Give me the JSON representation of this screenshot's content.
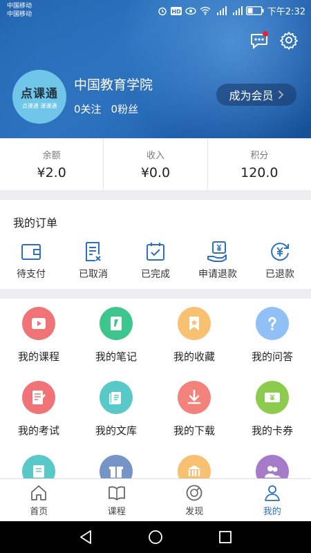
{
  "status_bar": {
    "carrier_line1": "中国移动",
    "carrier_line2": "中国移动",
    "time": "下午2:32",
    "icons": [
      "alarm-icon",
      "hd-icon",
      "eye-icon",
      "wifi-icon",
      "signal-4g-icon",
      "signal-2g-icon",
      "battery-icon"
    ]
  },
  "header": {
    "message_icon": "chat-icon",
    "settings_icon": "gear-icon",
    "has_notification": true,
    "avatar_text": "点课通",
    "avatar_subtext": "点课通 课课通",
    "name": "中国教育学院",
    "follow": "0关注",
    "fans": "0粉丝",
    "vip_label": "成为会员"
  },
  "stats": [
    {
      "label": "余额",
      "value": "¥2.0"
    },
    {
      "label": "收入",
      "value": "¥0.0"
    },
    {
      "label": "积分",
      "value": "120.0"
    }
  ],
  "orders": {
    "title": "我的订单",
    "items": [
      {
        "label": "待支付",
        "icon": "wallet-icon"
      },
      {
        "label": "已取消",
        "icon": "cancelled-doc-icon"
      },
      {
        "label": "已完成",
        "icon": "completed-check-icon"
      },
      {
        "label": "申请退款",
        "icon": "refund-request-icon"
      },
      {
        "label": "已退款",
        "icon": "refunded-icon"
      }
    ]
  },
  "services": [
    {
      "label": "我的课程",
      "icon": "course-play-icon",
      "color": "#f07377"
    },
    {
      "label": "我的笔记",
      "icon": "note-pen-icon",
      "color": "#3ec58e"
    },
    {
      "label": "我的收藏",
      "icon": "favorite-star-icon",
      "color": "#f8c071"
    },
    {
      "label": "我的问答",
      "icon": "question-icon",
      "color": "#90c0f6"
    },
    {
      "label": "我的考试",
      "icon": "exam-icon",
      "color": "#f07377"
    },
    {
      "label": "我的文库",
      "icon": "library-icon",
      "color": "#58c9c8"
    },
    {
      "label": "我的下载",
      "icon": "download-icon",
      "color": "#f4827c"
    },
    {
      "label": "我的卡券",
      "icon": "coupon-icon",
      "color": "#8dcb4f"
    },
    {
      "label": "",
      "icon": "certificate-icon",
      "color": "#58c9c8"
    },
    {
      "label": "",
      "icon": "gift-icon",
      "color": "#7794c6"
    },
    {
      "label": "",
      "icon": "institution-icon",
      "color": "#f8c071"
    },
    {
      "label": "",
      "icon": "group-icon",
      "color": "#a57ac9"
    }
  ],
  "tabbar": {
    "items": [
      {
        "label": "首页",
        "icon": "home-icon",
        "active": false
      },
      {
        "label": "课程",
        "icon": "book-icon",
        "active": false
      },
      {
        "label": "发现",
        "icon": "discover-icon",
        "active": false
      },
      {
        "label": "我的",
        "icon": "person-icon",
        "active": true
      }
    ],
    "active_color": "#2a6fc0"
  },
  "nav": {
    "back": "back-icon",
    "home": "home-circle-icon",
    "recents": "recents-icon"
  }
}
